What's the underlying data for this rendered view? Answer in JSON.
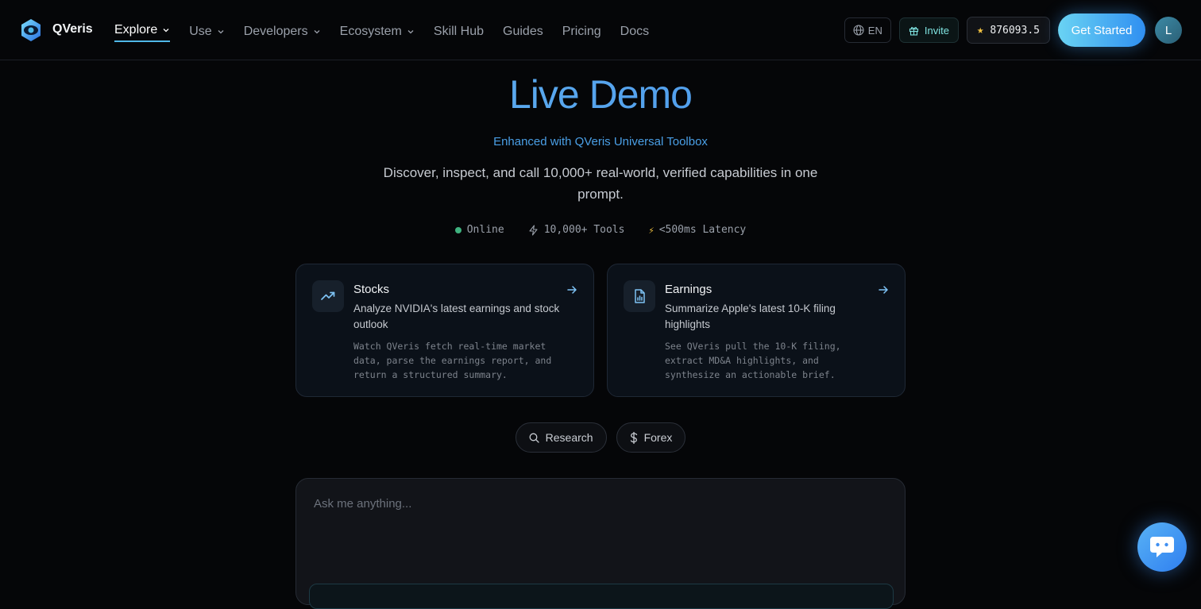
{
  "header": {
    "brand": "QVeris",
    "nav": [
      {
        "label": "Explore",
        "dropdown": true,
        "active": true
      },
      {
        "label": "Use",
        "dropdown": true
      },
      {
        "label": "Developers",
        "dropdown": true
      },
      {
        "label": "Ecosystem",
        "dropdown": true
      },
      {
        "label": "Skill Hub"
      },
      {
        "label": "Guides"
      },
      {
        "label": "Pricing"
      },
      {
        "label": "Docs"
      }
    ],
    "language": "EN",
    "invite": "Invite",
    "credits": "876093.5",
    "get_started": "Get Started",
    "avatar_initial": "L"
  },
  "hero": {
    "title": "Live Demo",
    "subtitle": "Enhanced with QVeris Universal Toolbox",
    "description": "Discover, inspect, and call 10,000+ real-world, verified capabilities in one prompt."
  },
  "stats": {
    "online": "Online",
    "tools": "10,000+ Tools",
    "latency": "<500ms Latency"
  },
  "cards": [
    {
      "icon": "trending-up-icon",
      "title": "Stocks",
      "subtitle": "Analyze NVIDIA's latest earnings and stock outlook",
      "body": "Watch QVeris fetch real-time market data, parse the earnings report, and return a structured summary."
    },
    {
      "icon": "document-chart-icon",
      "title": "Earnings",
      "subtitle": "Summarize Apple's latest 10-K filing highlights",
      "body": "See QVeris pull the 10-K filing, extract MD&A highlights, and synthesize an actionable brief."
    }
  ],
  "chips": [
    {
      "icon": "search-icon",
      "label": "Research"
    },
    {
      "icon": "dollar-icon",
      "label": "Forex"
    }
  ],
  "prompt": {
    "placeholder": "Ask me anything..."
  },
  "colors": {
    "accent": "#4fb8e8",
    "primary_gradient_start": "#6ad3f3",
    "primary_gradient_end": "#2f8ff1",
    "online": "#3fb27f",
    "star": "#f5c542"
  }
}
